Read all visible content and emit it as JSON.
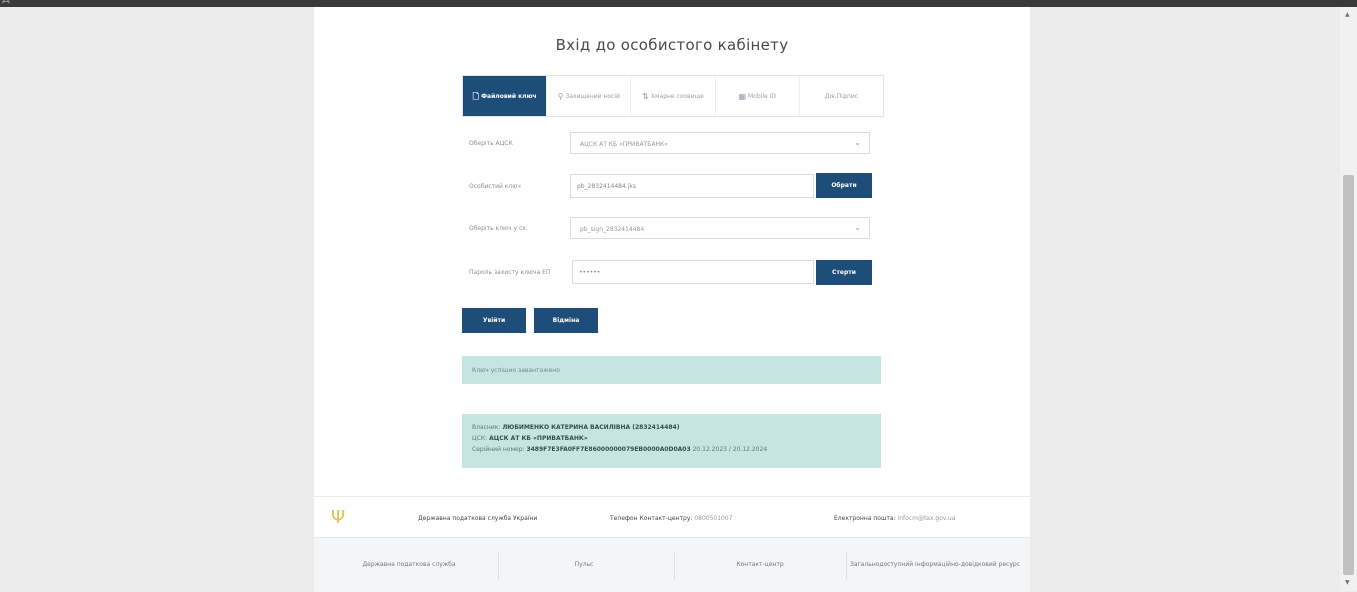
{
  "top": {
    "text": "Д"
  },
  "title": "Вхід до особистого кабінету",
  "tabs": [
    {
      "icon": "🗋",
      "label": "Файловий ключ",
      "active": true
    },
    {
      "icon": "⚲",
      "label": "Захищений носій",
      "active": false
    },
    {
      "icon": "⇅",
      "label": "Хмарне сховище",
      "active": false
    },
    {
      "icon": "▦",
      "label": "Mobile ID",
      "active": false
    },
    {
      "icon": "",
      "label": "Дія.Підпис",
      "active": false
    }
  ],
  "form": {
    "acsk_label": "Оберіть АЦСК",
    "acsk_value": "АЦСК АТ КБ «ПРИВАТБАНК»",
    "key_label": "Особистий ключ",
    "key_value": "pb_2832414484.jks",
    "key_button": "Обрати",
    "alias_label": "Оберіть ключ у сх.",
    "alias_value": "pb_sign_2832414484",
    "password_label": "Пароль захисту ключа ЕП",
    "password_value": "••••••",
    "password_button": "Стерти",
    "login_button": "Увійти",
    "cancel_button": "Відміна"
  },
  "notice": "Ключ успішно завантажено",
  "info": {
    "owner_label": "Власник:",
    "owner_value": "ЛЮБИМЕНКО КАТЕРИНА ВАСИЛІВНА (2832414484)",
    "ca_label": "ЦСК:",
    "ca_value": "АЦСК АТ КБ «ПРИВАТБАНК»",
    "serial_label": "Серійний номер:",
    "serial_value": "3489F7E3FA0FF7E86000000079EB0000A0D0A03",
    "serial_dates": "20.12.2023 / 20.12.2024"
  },
  "footer": {
    "org": "Державна податкова служба України",
    "phone_label": "Телефон Контакт-центру:",
    "phone_value": "0800501007",
    "email_label": "Електронна пошта:",
    "email_value": "infocm@tax.gov.ua",
    "links": [
      "Державна податкова служба",
      "Пульс",
      "Контакт-центр",
      "Загальнодоступний інформаційно-довідковий ресурс"
    ]
  },
  "colors": {
    "accent": "#1f4d7a",
    "notice_bg": "#c7e5e0",
    "trident": "#e0c050"
  }
}
